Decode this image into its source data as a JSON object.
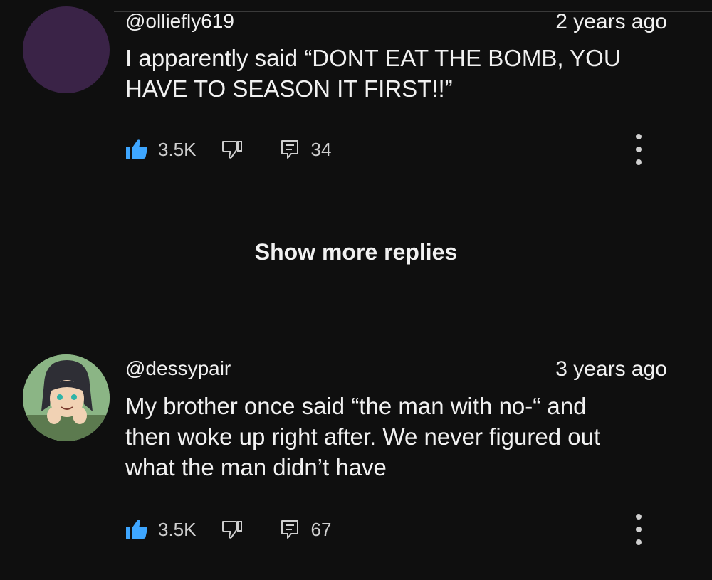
{
  "comments": [
    {
      "author": "@olliefly619",
      "timestamp": "2 years ago",
      "text_lines": [
        "I apparently said “DONT EAT THE BOMB, YOU",
        "HAVE TO SEASON IT FIRST!!”"
      ],
      "likes": "3.5K",
      "replies": "34",
      "avatar_color": "#3a2347"
    },
    {
      "author": "@dessypair",
      "timestamp": "3 years ago",
      "text_lines": [
        "My brother once said “the man with no-“ and",
        "then woke up right after. We never figured out",
        "what the man didn’t have"
      ],
      "likes": "3.5K",
      "replies": "67"
    }
  ],
  "show_more_label": "Show more replies",
  "icons": {
    "like": "thumbs-up-icon",
    "dislike": "thumbs-down-icon",
    "reply": "reply-comment-icon",
    "more": "more-vertical-icon"
  },
  "colors": {
    "background": "#0f0f0f",
    "accent_like": "#3ea6ff",
    "text": "#f1f1f1"
  }
}
